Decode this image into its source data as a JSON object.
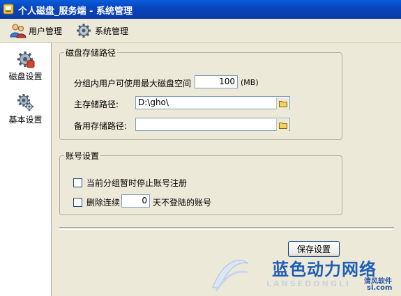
{
  "window": {
    "title": "个人磁盘_服务端 - 系统管理"
  },
  "menu": {
    "user_manage": "用户管理",
    "system_manage": "系统管理"
  },
  "sidebar": {
    "items": [
      {
        "label": "磁盘设置",
        "icon": "gear-disk-icon"
      },
      {
        "label": "基本设置",
        "icon": "gears-icon"
      }
    ]
  },
  "disk_group": {
    "legend": "磁盘存储路径",
    "max_space_label": "分组内用户可使用最大磁盘空间",
    "max_space_value": "100",
    "max_space_unit": "(MB)",
    "main_path_label": "主存储路径:",
    "main_path_value": "D:\\gho\\",
    "backup_path_label": "备用存储路径:",
    "backup_path_value": ""
  },
  "account_group": {
    "legend": "账号设置",
    "stop_register_label": "当前分组暂时停止账号注册",
    "stop_register_checked": false,
    "delete_prefix": "删除连续",
    "delete_days": "0",
    "delete_suffix": "天不登陆的账号",
    "delete_checked": false
  },
  "actions": {
    "save": "保存设置"
  },
  "watermark": {
    "cn_text": "蓝色动力网络",
    "en_text": "LANSEDONGLI",
    "small_text": "清风软件",
    "domain": "sl.com"
  },
  "colors": {
    "titlebar": "#0a46c0",
    "watermark_blue": "#1f5fb8"
  }
}
